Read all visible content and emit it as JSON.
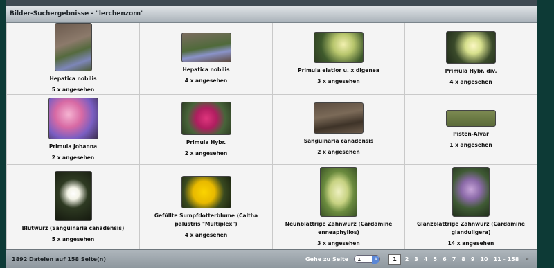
{
  "header": {
    "title": "Bilder-Suchergebnisse - \"lerchenzorn\""
  },
  "results": [
    {
      "name": "Hepatica nobilis",
      "views": "5 x angesehen"
    },
    {
      "name": "Hepatica nobilis",
      "views": "4 x angesehen"
    },
    {
      "name": "Primula elatior u. x digenea",
      "views": "3 x angesehen"
    },
    {
      "name": "Primula Hybr. div.",
      "views": "4 x angesehen"
    },
    {
      "name": "Primula Johanna",
      "views": "2 x angesehen"
    },
    {
      "name": "Primula Hybr.",
      "views": "2 x angesehen"
    },
    {
      "name": "Sanguinaria canadensis",
      "views": "2 x angesehen"
    },
    {
      "name": "Pisten-Alvar",
      "views": "1 x angesehen"
    },
    {
      "name": "Blutwurz (Sanguinaria canadensis)",
      "views": "5 x angesehen"
    },
    {
      "name": "Gefüllte Sumpfdotterblume (Caltha palustris \"Multiplex\")",
      "views": "4 x angesehen"
    },
    {
      "name": "Neunblättrige Zahnwurz (Cardamine enneaphyllos)",
      "views": "3 x angesehen"
    },
    {
      "name": "Glanzblättrige Zahnwurz (Cardamine glanduligera)",
      "views": "14 x angesehen"
    }
  ],
  "footer": {
    "count": "1892 Dateien auf 158 Seite(n)",
    "goto_label": "Gehe zu Seite",
    "page_select_value": "1",
    "pages": [
      "1",
      "2",
      "3",
      "4",
      "5",
      "6",
      "7",
      "8",
      "9",
      "10",
      "11 - 158"
    ],
    "last_icon": "double-chevron-right-icon"
  }
}
